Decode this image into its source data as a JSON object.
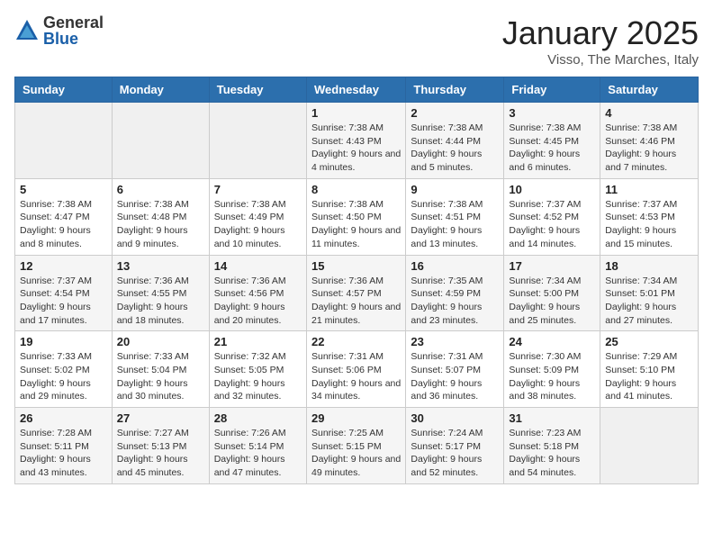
{
  "logo": {
    "general": "General",
    "blue": "Blue"
  },
  "title": "January 2025",
  "location": "Visso, The Marches, Italy",
  "days_of_week": [
    "Sunday",
    "Monday",
    "Tuesday",
    "Wednesday",
    "Thursday",
    "Friday",
    "Saturday"
  ],
  "weeks": [
    [
      {
        "day": "",
        "empty": true
      },
      {
        "day": "",
        "empty": true
      },
      {
        "day": "",
        "empty": true
      },
      {
        "day": "1",
        "sunrise": "Sunrise: 7:38 AM",
        "sunset": "Sunset: 4:43 PM",
        "daylight": "Daylight: 9 hours and 4 minutes."
      },
      {
        "day": "2",
        "sunrise": "Sunrise: 7:38 AM",
        "sunset": "Sunset: 4:44 PM",
        "daylight": "Daylight: 9 hours and 5 minutes."
      },
      {
        "day": "3",
        "sunrise": "Sunrise: 7:38 AM",
        "sunset": "Sunset: 4:45 PM",
        "daylight": "Daylight: 9 hours and 6 minutes."
      },
      {
        "day": "4",
        "sunrise": "Sunrise: 7:38 AM",
        "sunset": "Sunset: 4:46 PM",
        "daylight": "Daylight: 9 hours and 7 minutes."
      }
    ],
    [
      {
        "day": "5",
        "sunrise": "Sunrise: 7:38 AM",
        "sunset": "Sunset: 4:47 PM",
        "daylight": "Daylight: 9 hours and 8 minutes."
      },
      {
        "day": "6",
        "sunrise": "Sunrise: 7:38 AM",
        "sunset": "Sunset: 4:48 PM",
        "daylight": "Daylight: 9 hours and 9 minutes."
      },
      {
        "day": "7",
        "sunrise": "Sunrise: 7:38 AM",
        "sunset": "Sunset: 4:49 PM",
        "daylight": "Daylight: 9 hours and 10 minutes."
      },
      {
        "day": "8",
        "sunrise": "Sunrise: 7:38 AM",
        "sunset": "Sunset: 4:50 PM",
        "daylight": "Daylight: 9 hours and 11 minutes."
      },
      {
        "day": "9",
        "sunrise": "Sunrise: 7:38 AM",
        "sunset": "Sunset: 4:51 PM",
        "daylight": "Daylight: 9 hours and 13 minutes."
      },
      {
        "day": "10",
        "sunrise": "Sunrise: 7:37 AM",
        "sunset": "Sunset: 4:52 PM",
        "daylight": "Daylight: 9 hours and 14 minutes."
      },
      {
        "day": "11",
        "sunrise": "Sunrise: 7:37 AM",
        "sunset": "Sunset: 4:53 PM",
        "daylight": "Daylight: 9 hours and 15 minutes."
      }
    ],
    [
      {
        "day": "12",
        "sunrise": "Sunrise: 7:37 AM",
        "sunset": "Sunset: 4:54 PM",
        "daylight": "Daylight: 9 hours and 17 minutes."
      },
      {
        "day": "13",
        "sunrise": "Sunrise: 7:36 AM",
        "sunset": "Sunset: 4:55 PM",
        "daylight": "Daylight: 9 hours and 18 minutes."
      },
      {
        "day": "14",
        "sunrise": "Sunrise: 7:36 AM",
        "sunset": "Sunset: 4:56 PM",
        "daylight": "Daylight: 9 hours and 20 minutes."
      },
      {
        "day": "15",
        "sunrise": "Sunrise: 7:36 AM",
        "sunset": "Sunset: 4:57 PM",
        "daylight": "Daylight: 9 hours and 21 minutes."
      },
      {
        "day": "16",
        "sunrise": "Sunrise: 7:35 AM",
        "sunset": "Sunset: 4:59 PM",
        "daylight": "Daylight: 9 hours and 23 minutes."
      },
      {
        "day": "17",
        "sunrise": "Sunrise: 7:34 AM",
        "sunset": "Sunset: 5:00 PM",
        "daylight": "Daylight: 9 hours and 25 minutes."
      },
      {
        "day": "18",
        "sunrise": "Sunrise: 7:34 AM",
        "sunset": "Sunset: 5:01 PM",
        "daylight": "Daylight: 9 hours and 27 minutes."
      }
    ],
    [
      {
        "day": "19",
        "sunrise": "Sunrise: 7:33 AM",
        "sunset": "Sunset: 5:02 PM",
        "daylight": "Daylight: 9 hours and 29 minutes."
      },
      {
        "day": "20",
        "sunrise": "Sunrise: 7:33 AM",
        "sunset": "Sunset: 5:04 PM",
        "daylight": "Daylight: 9 hours and 30 minutes."
      },
      {
        "day": "21",
        "sunrise": "Sunrise: 7:32 AM",
        "sunset": "Sunset: 5:05 PM",
        "daylight": "Daylight: 9 hours and 32 minutes."
      },
      {
        "day": "22",
        "sunrise": "Sunrise: 7:31 AM",
        "sunset": "Sunset: 5:06 PM",
        "daylight": "Daylight: 9 hours and 34 minutes."
      },
      {
        "day": "23",
        "sunrise": "Sunrise: 7:31 AM",
        "sunset": "Sunset: 5:07 PM",
        "daylight": "Daylight: 9 hours and 36 minutes."
      },
      {
        "day": "24",
        "sunrise": "Sunrise: 7:30 AM",
        "sunset": "Sunset: 5:09 PM",
        "daylight": "Daylight: 9 hours and 38 minutes."
      },
      {
        "day": "25",
        "sunrise": "Sunrise: 7:29 AM",
        "sunset": "Sunset: 5:10 PM",
        "daylight": "Daylight: 9 hours and 41 minutes."
      }
    ],
    [
      {
        "day": "26",
        "sunrise": "Sunrise: 7:28 AM",
        "sunset": "Sunset: 5:11 PM",
        "daylight": "Daylight: 9 hours and 43 minutes."
      },
      {
        "day": "27",
        "sunrise": "Sunrise: 7:27 AM",
        "sunset": "Sunset: 5:13 PM",
        "daylight": "Daylight: 9 hours and 45 minutes."
      },
      {
        "day": "28",
        "sunrise": "Sunrise: 7:26 AM",
        "sunset": "Sunset: 5:14 PM",
        "daylight": "Daylight: 9 hours and 47 minutes."
      },
      {
        "day": "29",
        "sunrise": "Sunrise: 7:25 AM",
        "sunset": "Sunset: 5:15 PM",
        "daylight": "Daylight: 9 hours and 49 minutes."
      },
      {
        "day": "30",
        "sunrise": "Sunrise: 7:24 AM",
        "sunset": "Sunset: 5:17 PM",
        "daylight": "Daylight: 9 hours and 52 minutes."
      },
      {
        "day": "31",
        "sunrise": "Sunrise: 7:23 AM",
        "sunset": "Sunset: 5:18 PM",
        "daylight": "Daylight: 9 hours and 54 minutes."
      },
      {
        "day": "",
        "empty": true
      }
    ]
  ]
}
